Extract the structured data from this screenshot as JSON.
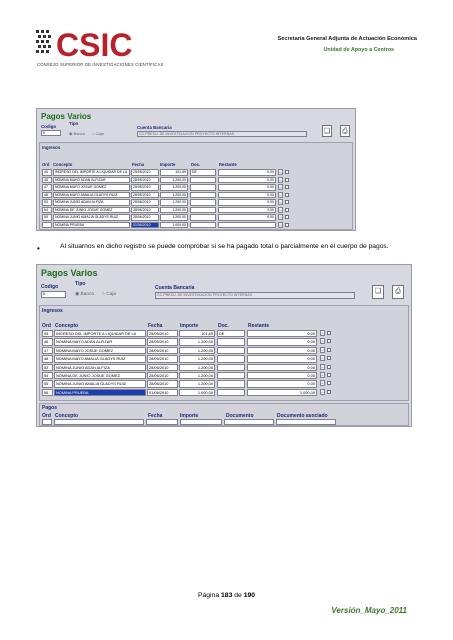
{
  "header": {
    "org_logo_text": "CSIC",
    "org_subtitle": "CONSEJO SUPERIOR DE INVESTIGACIONES CIENTÍFICAS",
    "unit_title": "Secretaría General Adjunta de Actuación Económica",
    "unit_subtitle": "Unidad de Apoyo a Centros"
  },
  "screen1": {
    "title": "Pagos Varios",
    "codigo_label": "Codigo",
    "codigo_value": "5",
    "tipo_label": "Tipo",
    "tipo_opt1": "Banco",
    "tipo_opt2": "Caja",
    "cuenta_label": "Cuenta Bancaria",
    "cuenta_value": "CC.PRESU. DE INVESTIGACION PROYECTO INTERNAS",
    "ingresos_label": "Ingresos",
    "cols": {
      "ord": "Ord",
      "concepto": "Concepto",
      "fecha": "Fecha",
      "importe": "Importe",
      "doc": "Doc.",
      "restante": "Restante"
    },
    "rows": [
      {
        "ord": "45",
        "concepto": "INGRESO DEL IMPORTE A LIQUIDAR DE LA",
        "fecha": "25/05/2010",
        "importe": "101,69",
        "doc": "DE",
        "restante": "0,00"
      },
      {
        "ord": "46",
        "concepto": "NOMINA MAYO ADAN ALFIZAR",
        "fecha": "28/05/2010",
        "importe": "1.200,00",
        "doc": "",
        "restante": "0,00"
      },
      {
        "ord": "47",
        "concepto": "NOMINA MAYO JOSUE GOMEZ",
        "fecha": "28/05/2010",
        "importe": "1.200,00",
        "doc": "",
        "restante": "0,00"
      },
      {
        "ord": "48",
        "concepto": "NOMINA MAYO AMALIA GLADYS RUIZ",
        "fecha": "28/05/2010",
        "importe": "1.200,00",
        "doc": "",
        "restante": "0,00"
      },
      {
        "ord": "53",
        "concepto": "NOMINA JUNIO ADAN ALFIZA",
        "fecha": "28/06/2010",
        "importe": "1.200,00",
        "doc": "",
        "restante": "0,00"
      },
      {
        "ord": "54",
        "concepto": "NOMINA DE JUNIO JOSUE GOMEZ",
        "fecha": "28/06/2010",
        "importe": "1.200,00",
        "doc": "",
        "restante": "0,00"
      },
      {
        "ord": "55",
        "concepto": "NOMINA JUNIO AMALIA GLADYS RUIZ",
        "fecha": "28/06/2010",
        "importe": "1.200,00",
        "doc": "",
        "restante": "0,00"
      },
      {
        "ord": "",
        "concepto": "NOMINA PRUEBA",
        "fecha": "01/06/2010",
        "importe": "1.000,00",
        "doc": "",
        "restante": ""
      }
    ]
  },
  "bullet_text": "Al situarnos en dicho registro se puede comprobar si se ha pagado total o parcialmente en el cuerpo de pagos.",
  "screen2": {
    "title": "Pagos Varios",
    "codigo_label": "Codigo",
    "codigo_value": "5",
    "tipo_label": "Tipo",
    "tipo_opt1": "Banco",
    "tipo_opt2": "Caja",
    "cuenta_label": "Cuenta Bancaria",
    "cuenta_value": "CC.PRESU. DE INVESTIGACION PROYECTO INTERNAS",
    "ingresos_label": "Ingresos",
    "cols": {
      "ord": "Ord",
      "concepto": "Concepto",
      "fecha": "Fecha",
      "importe": "Importe",
      "doc": "Doc.",
      "restante": "Restante"
    },
    "rows": [
      {
        "ord": "45",
        "concepto": "INGRESO DEL IMPORTE A LIQUIDAR DE LA",
        "fecha": "25/05/2010",
        "importe": "101,69",
        "doc": "DE",
        "restante": "0,00"
      },
      {
        "ord": "46",
        "concepto": "NOMINA MAYO ADAN ALFIZAR",
        "fecha": "28/05/2010",
        "importe": "1.200,00",
        "doc": "",
        "restante": "0,00"
      },
      {
        "ord": "47",
        "concepto": "NOMINA MAYO JOSUE GOMEZ",
        "fecha": "28/05/2010",
        "importe": "1.200,00",
        "doc": "",
        "restante": "0,00"
      },
      {
        "ord": "48",
        "concepto": "NOMINA MAYO AMALIA GLADYS RUIZ",
        "fecha": "28/05/2010",
        "importe": "1.200,00",
        "doc": "",
        "restante": "0,00"
      },
      {
        "ord": "53",
        "concepto": "NOMINA JUNIO ADAN ALFIZA",
        "fecha": "28/06/2010",
        "importe": "1.200,00",
        "doc": "",
        "restante": "0,00"
      },
      {
        "ord": "54",
        "concepto": "NOMINA DE JUNIO JOSUE GOMEZ",
        "fecha": "28/06/2010",
        "importe": "1.200,00",
        "doc": "",
        "restante": "0,00"
      },
      {
        "ord": "55",
        "concepto": "NOMINA JUNIO AMALIA GLADYS RUIZ",
        "fecha": "28/06/2010",
        "importe": "1.200,00",
        "doc": "",
        "restante": "0,00"
      },
      {
        "ord": "56",
        "concepto": "NOMINA PRUEBA",
        "fecha": "01/06/2010",
        "importe": "1.000,00",
        "doc": "",
        "restante": "1.000,00"
      }
    ],
    "pagos_label": "Pagos",
    "pagos_cols": {
      "ord": "Ord",
      "concepto": "Concepto",
      "fecha": "Fecha",
      "importe": "Importe",
      "documento": "Documento",
      "asociado": "Documento asociado"
    }
  },
  "footer": {
    "page_prefix": "Página ",
    "page_num": "183",
    "page_mid": " de ",
    "page_total": "190",
    "version": "Versión_Mayo_2011"
  },
  "colors": {
    "accent_green": "#3b7a2a",
    "title_green": "#1c6b1c",
    "label_blue": "#1c2a78",
    "selection": "#1c3fb0"
  },
  "icons": [
    "csic-logo",
    "paste-icon",
    "printer-icon",
    "bullet-icon"
  ]
}
